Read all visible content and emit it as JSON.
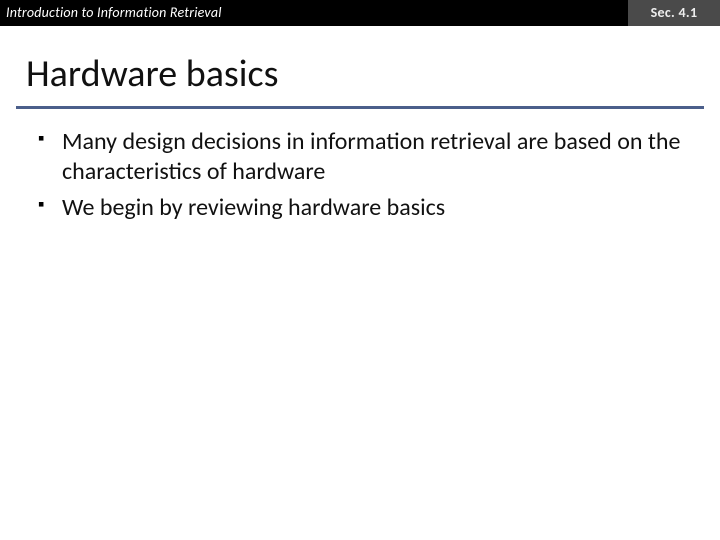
{
  "header": {
    "course": "Introduction to Information Retrieval",
    "section": "Sec. 4.1"
  },
  "title": "Hardware basics",
  "bullets": [
    "Many design decisions in information retrieval are based on the characteristics of hardware",
    "We begin by reviewing hardware basics"
  ]
}
